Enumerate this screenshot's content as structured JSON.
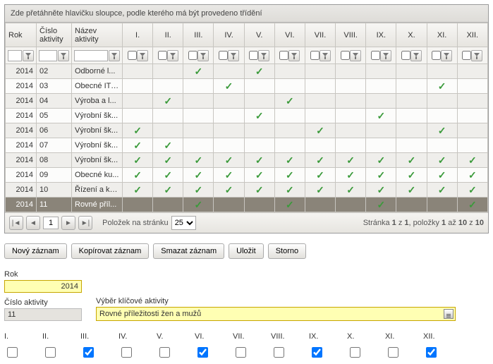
{
  "groupHeader": "Zde přetáhněte hlavičku sloupce, podle kterého má být provedeno třídění",
  "columns": {
    "rok": "Rok",
    "cislo": "Číslo aktivity",
    "nazev": "Název aktivity",
    "months": [
      "I.",
      "II.",
      "III.",
      "IV.",
      "V.",
      "VI.",
      "VII.",
      "VIII.",
      "IX.",
      "X.",
      "XI.",
      "XII."
    ]
  },
  "rows": [
    {
      "rok": "2014",
      "cislo": "02",
      "nazev": "Odborné l...",
      "m": [
        0,
        0,
        1,
        0,
        1,
        0,
        0,
        0,
        0,
        0,
        0,
        0
      ]
    },
    {
      "rok": "2014",
      "cislo": "03",
      "nazev": "Obecné IT ...",
      "m": [
        0,
        0,
        0,
        1,
        0,
        0,
        0,
        0,
        0,
        0,
        1,
        0
      ]
    },
    {
      "rok": "2014",
      "cislo": "04",
      "nazev": "Výroba a l...",
      "m": [
        0,
        1,
        0,
        0,
        0,
        1,
        0,
        0,
        0,
        0,
        0,
        0
      ]
    },
    {
      "rok": "2014",
      "cislo": "05",
      "nazev": "Výrobní šk...",
      "m": [
        0,
        0,
        0,
        0,
        1,
        0,
        0,
        0,
        1,
        0,
        0,
        0
      ]
    },
    {
      "rok": "2014",
      "cislo": "06",
      "nazev": "Výrobní šk...",
      "m": [
        1,
        0,
        0,
        0,
        0,
        0,
        1,
        0,
        0,
        0,
        1,
        0
      ]
    },
    {
      "rok": "2014",
      "cislo": "07",
      "nazev": "Výrobní šk...",
      "m": [
        1,
        1,
        0,
        0,
        0,
        0,
        0,
        0,
        0,
        0,
        0,
        0
      ]
    },
    {
      "rok": "2014",
      "cislo": "08",
      "nazev": "Výrobní šk...",
      "m": [
        1,
        1,
        1,
        1,
        1,
        1,
        1,
        1,
        1,
        1,
        1,
        1
      ]
    },
    {
      "rok": "2014",
      "cislo": "09",
      "nazev": "Obecné ku...",
      "m": [
        1,
        1,
        1,
        1,
        1,
        1,
        1,
        1,
        1,
        1,
        1,
        1
      ]
    },
    {
      "rok": "2014",
      "cislo": "10",
      "nazev": "Řízení a ko...",
      "m": [
        1,
        1,
        1,
        1,
        1,
        1,
        1,
        1,
        1,
        1,
        1,
        1
      ]
    },
    {
      "rok": "2014",
      "cislo": "11",
      "nazev": "Rovné příl...",
      "m": [
        0,
        0,
        1,
        0,
        0,
        1,
        0,
        0,
        1,
        0,
        0,
        1
      ],
      "selected": true
    }
  ],
  "pager": {
    "page": "1",
    "sizeLabel": "Položek na stránku",
    "size": "25",
    "statusPrefix": "Stránka ",
    "statusPage": "1",
    "statusOf": " z ",
    "statusPages": "1",
    "statusItems": ", položky ",
    "statusFrom": "1",
    "statusTo": " až ",
    "statusToN": "10",
    "statusOf2": " z ",
    "statusTotal": "10"
  },
  "buttons": {
    "novy": "Nový záznam",
    "kopirovat": "Kopírovat záznam",
    "smazat": "Smazat záznam",
    "ulozit": "Uložit",
    "storno": "Storno"
  },
  "form": {
    "rokLabel": "Rok",
    "rokValue": "2014",
    "cisloLabel": "Číslo aktivity",
    "cisloValue": "11",
    "vyberLabel": "Výběr klíčové aktivity",
    "vyberValue": "Rovné příležitosti žen a mužů",
    "monthLabels": [
      "I.",
      "II.",
      "III.",
      "IV.",
      "V.",
      "VI.",
      "VII.",
      "VIII.",
      "IX.",
      "X.",
      "XI.",
      "XII."
    ],
    "monthChecked": [
      false,
      false,
      true,
      false,
      false,
      true,
      false,
      false,
      true,
      false,
      false,
      true
    ]
  }
}
